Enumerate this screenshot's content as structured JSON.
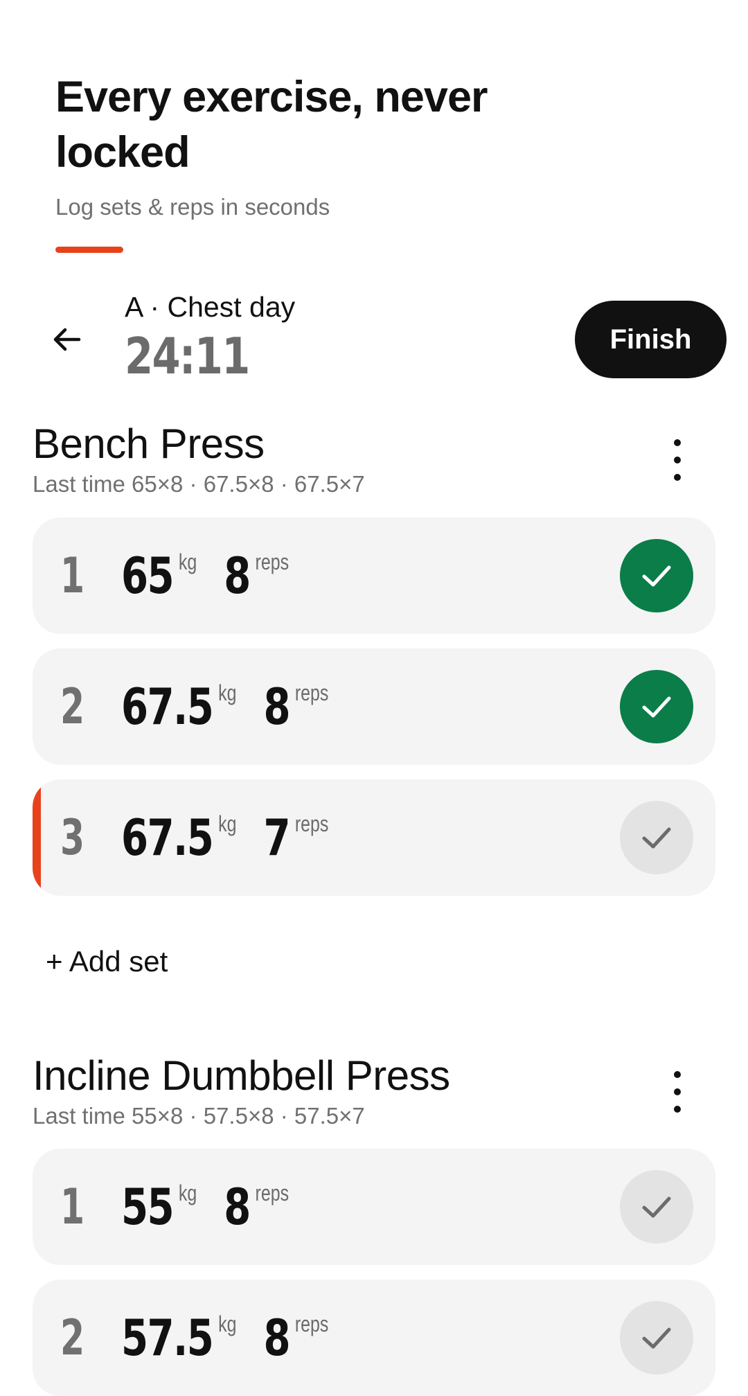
{
  "hero": {
    "title": "Every exercise, never locked",
    "subtitle": "Log sets & reps in seconds",
    "accent_color": "#e8421c"
  },
  "topbar": {
    "back_icon": "arrow-left-icon",
    "session_name": "A · Chest day",
    "timer": "24:11",
    "finish_label": "Finish"
  },
  "exercises": [
    {
      "name": "Bench Press",
      "last_time": "Last time 65×8 · 67.5×8 · 67.5×7",
      "menu_icon": "more-vertical-icon",
      "sets": [
        {
          "num": "1",
          "weight": "65",
          "weight_unit": "kg",
          "reps": "8",
          "reps_unit": "reps",
          "done": true
        },
        {
          "num": "2",
          "weight": "67.5",
          "weight_unit": "kg",
          "reps": "8",
          "reps_unit": "reps",
          "done": true
        },
        {
          "num": "3",
          "weight": "67.5",
          "weight_unit": "kg",
          "reps": "7",
          "reps_unit": "reps",
          "done": false,
          "active": true
        }
      ],
      "add_set_label": "+ Add set"
    },
    {
      "name": "Incline Dumbbell Press",
      "last_time": "Last time 55×8 · 57.5×8 · 57.5×7",
      "menu_icon": "more-vertical-icon",
      "sets": [
        {
          "num": "1",
          "weight": "55",
          "weight_unit": "kg",
          "reps": "8",
          "reps_unit": "reps",
          "done": false
        },
        {
          "num": "2",
          "weight": "57.5",
          "weight_unit": "kg",
          "reps": "8",
          "reps_unit": "reps",
          "done": false
        }
      ]
    }
  ],
  "colors": {
    "done": "#0a7d48",
    "pending": "#e3e3e3",
    "row_bg": "#f4f4f4",
    "active": "#e8421c",
    "primary_button": "#111111"
  }
}
